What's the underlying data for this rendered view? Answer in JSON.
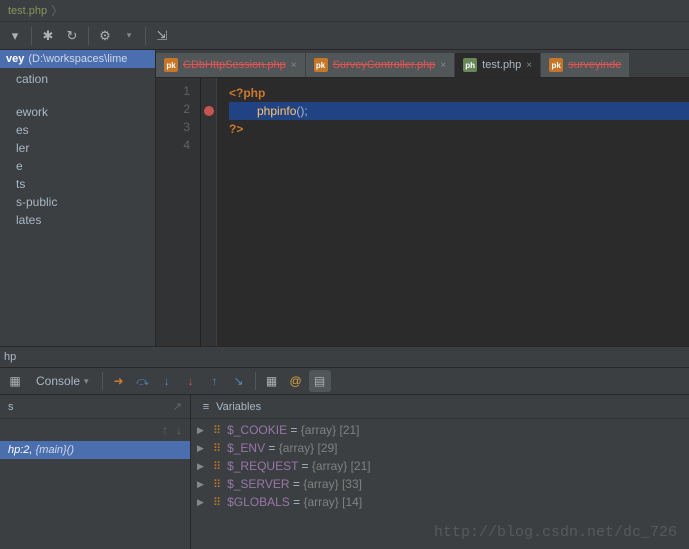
{
  "breadcrumb": {
    "file": "test.php"
  },
  "toolbar": {
    "collapse": "▾",
    "target": "✱",
    "refresh": "↻",
    "settings": "⚙",
    "dropdown": "▾",
    "shrink": "⇲"
  },
  "project": {
    "name": "vey",
    "path": "(D:\\workspaces\\lime"
  },
  "tree": {
    "items": [
      "cation",
      "",
      "ework",
      "es",
      "ler",
      "e",
      "ts",
      "s-public",
      "lates"
    ]
  },
  "tabs": [
    {
      "label": "CDbHttpSession.php",
      "strikethrough": true,
      "active": false
    },
    {
      "label": "SurveyController.php",
      "strikethrough": true,
      "active": false
    },
    {
      "label": "test.php",
      "strikethrough": false,
      "active": true
    },
    {
      "label": "surveyinde",
      "strikethrough": true,
      "active": false
    }
  ],
  "code": {
    "lines": [
      "1",
      "2",
      "3",
      "4"
    ],
    "line1": "<?php",
    "line2_fn": "phpinfo",
    "line2_rest": "();",
    "line3": "?>"
  },
  "debug": {
    "php_tab": "hp",
    "console_label": "Console",
    "frames_header": "s",
    "variables_header": "Variables",
    "frame_text": "hp:2,",
    "frame_main": "{main}()",
    "icons": {
      "arrow": "➜",
      "step_over": "⤼",
      "step_into": "↓",
      "force_step": "↓",
      "step_out": "↑",
      "run_to": "↘",
      "eval": "▦",
      "at": "@",
      "settings": "▤"
    }
  },
  "variables": [
    {
      "name": "$_COOKIE",
      "type": "{array}",
      "size": "[21]"
    },
    {
      "name": "$_ENV",
      "type": "{array}",
      "size": "[29]"
    },
    {
      "name": "$_REQUEST",
      "type": "{array}",
      "size": "[21]"
    },
    {
      "name": "$_SERVER",
      "type": "{array}",
      "size": "[33]"
    },
    {
      "name": "$GLOBALS",
      "type": "{array}",
      "size": "[14]"
    }
  ],
  "watermark": "http://blog.csdn.net/dc_726"
}
